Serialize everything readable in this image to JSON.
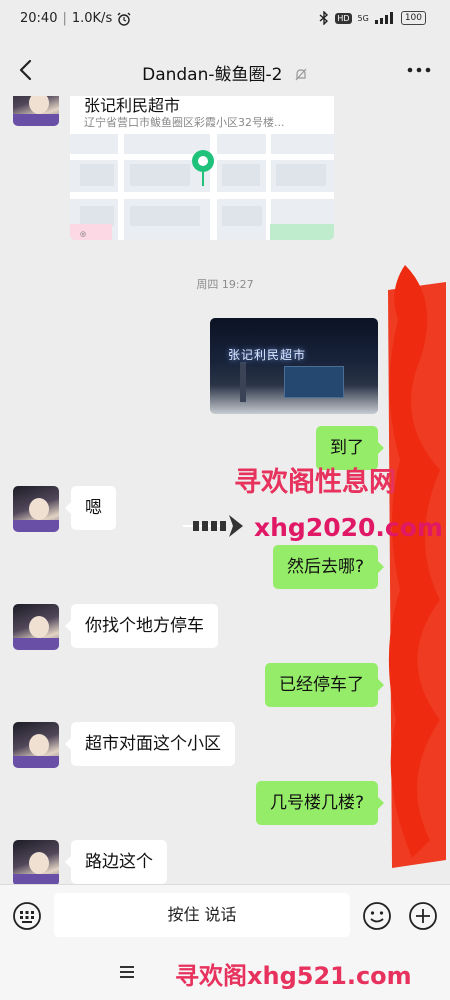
{
  "status_bar": {
    "time": "20:40",
    "speed": "1.0K/s",
    "network": "5G",
    "hd": "HD",
    "battery": "100"
  },
  "header": {
    "title": "Dandan-鲅鱼圈-2"
  },
  "location_card": {
    "name": "张记利民超市",
    "address": "辽宁省营口市鲅鱼圈区彩霞小区32号楼..."
  },
  "timestamp": "周四 19:27",
  "photo": {
    "sign_text": "张记利民超市"
  },
  "messages": [
    {
      "side": "out",
      "text": "到了"
    },
    {
      "side": "in",
      "text": "嗯"
    },
    {
      "side": "out",
      "text": "然后去哪?"
    },
    {
      "side": "in",
      "text": "你找个地方停车"
    },
    {
      "side": "out",
      "text": "已经停车了"
    },
    {
      "side": "in",
      "text": "超市对面这个小区"
    },
    {
      "side": "out",
      "text": "几号楼几楼?"
    },
    {
      "side": "in",
      "text": "路边这个"
    }
  ],
  "watermarks": {
    "top": "寻欢阁性息网",
    "middle": "xhg2020.com",
    "bottom": "寻欢阁xhg521.com"
  },
  "input_bar": {
    "hold_to_talk": "按住 说话"
  },
  "colors": {
    "background": "#ededed",
    "bubble_out": "#95ec69",
    "bubble_in": "#ffffff",
    "scribble": "#ee2b10",
    "watermark": "#e8325e"
  }
}
